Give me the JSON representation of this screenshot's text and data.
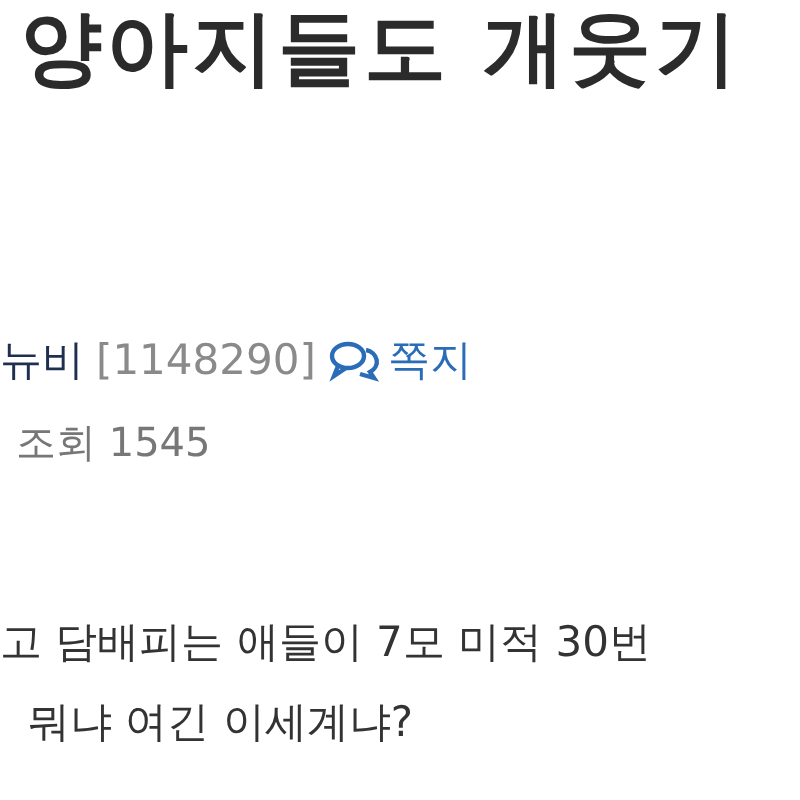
{
  "post": {
    "title": "양아지들도 개웃기",
    "author": {
      "name": "뉴비",
      "id": "[1148290]",
      "message_link": "쪽지"
    },
    "views": "조회 1545",
    "body": [
      "고 담배피는 애들이 7모 미적 30번",
      "뭐냐 여긴 이세계냐?"
    ]
  }
}
